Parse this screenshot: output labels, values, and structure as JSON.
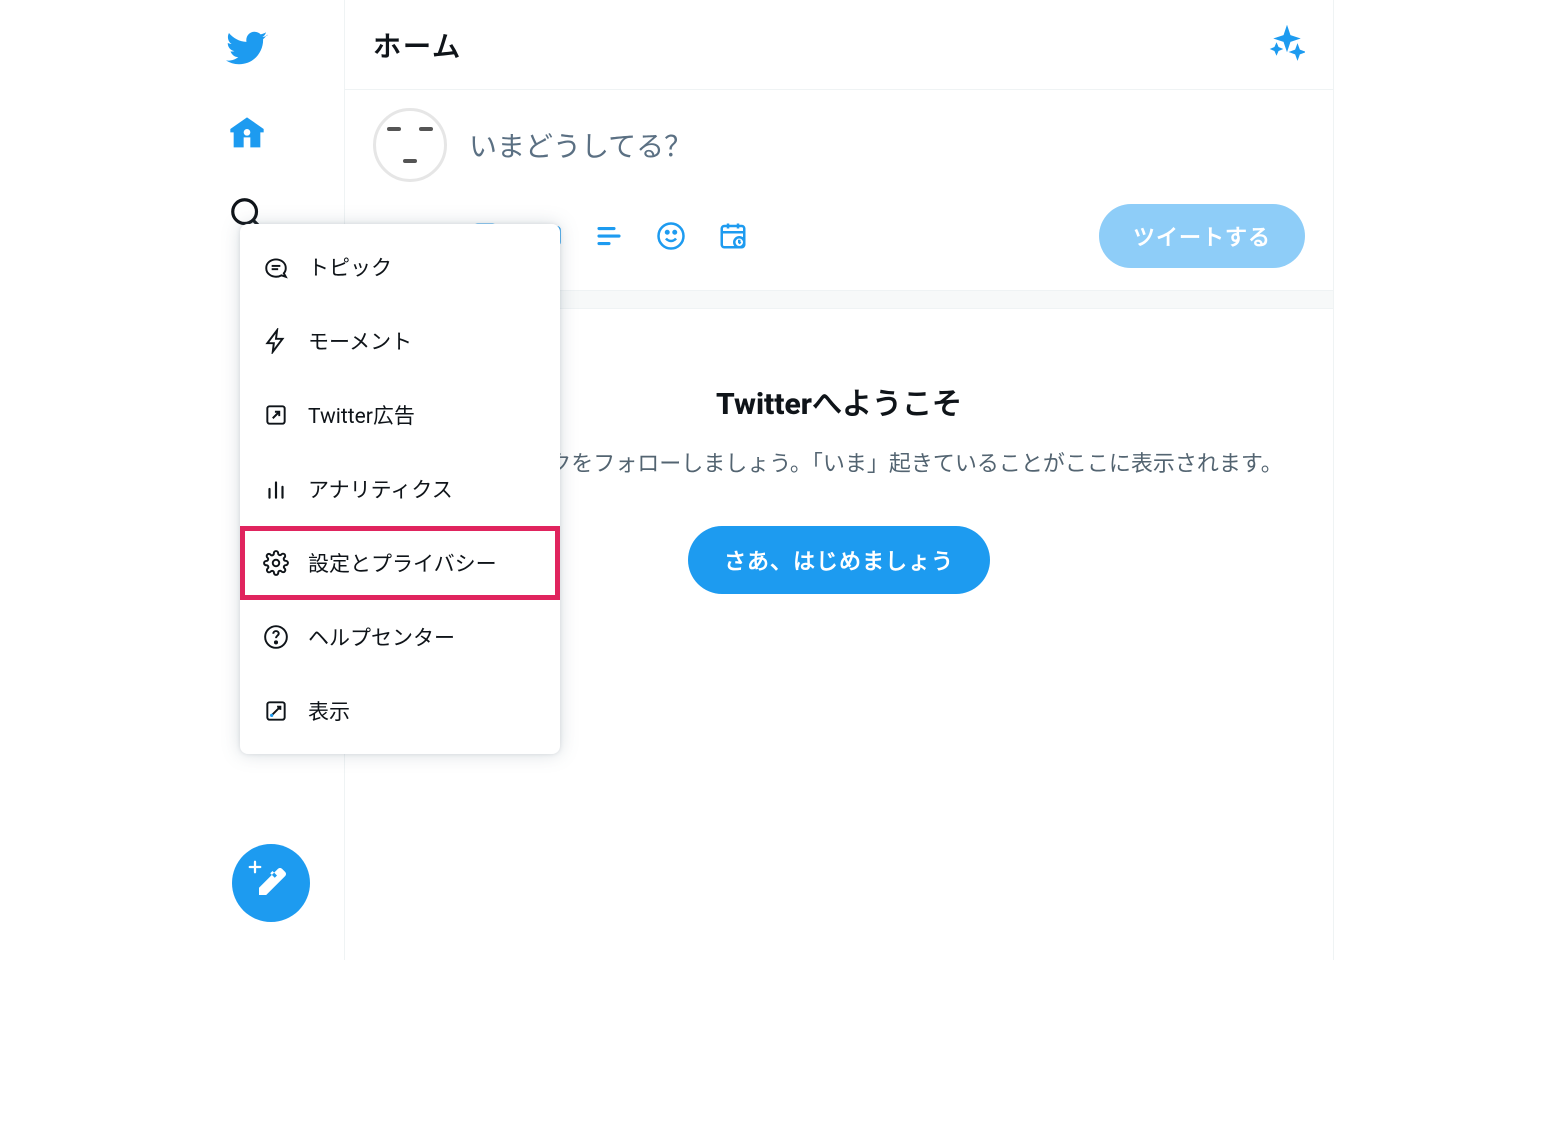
{
  "header": {
    "title": "ホーム"
  },
  "composer": {
    "placeholder": "いまどうしてる？",
    "tweet_button": "ツイートする",
    "icons": [
      "image",
      "gif",
      "poll",
      "emoji",
      "schedule"
    ]
  },
  "welcome": {
    "heading": "Twitterへようこそ",
    "body": "ウントやトピックをフォローしましょう。「いま」起きていることがここに表示されます。",
    "cta": "さあ、はじめましょう"
  },
  "more_menu": {
    "items": [
      {
        "icon": "topic",
        "label": "トピック"
      },
      {
        "icon": "lightning",
        "label": "モーメント"
      },
      {
        "icon": "external",
        "label": "Twitter広告"
      },
      {
        "icon": "chart",
        "label": "アナリティクス"
      },
      {
        "icon": "gear",
        "label": "設定とプライバシー",
        "highlight": true
      },
      {
        "icon": "help",
        "label": "ヘルプセンター"
      },
      {
        "icon": "display",
        "label": "表示"
      }
    ]
  },
  "colors": {
    "primary": "#1d9bf0",
    "highlight": "#e0245e"
  }
}
